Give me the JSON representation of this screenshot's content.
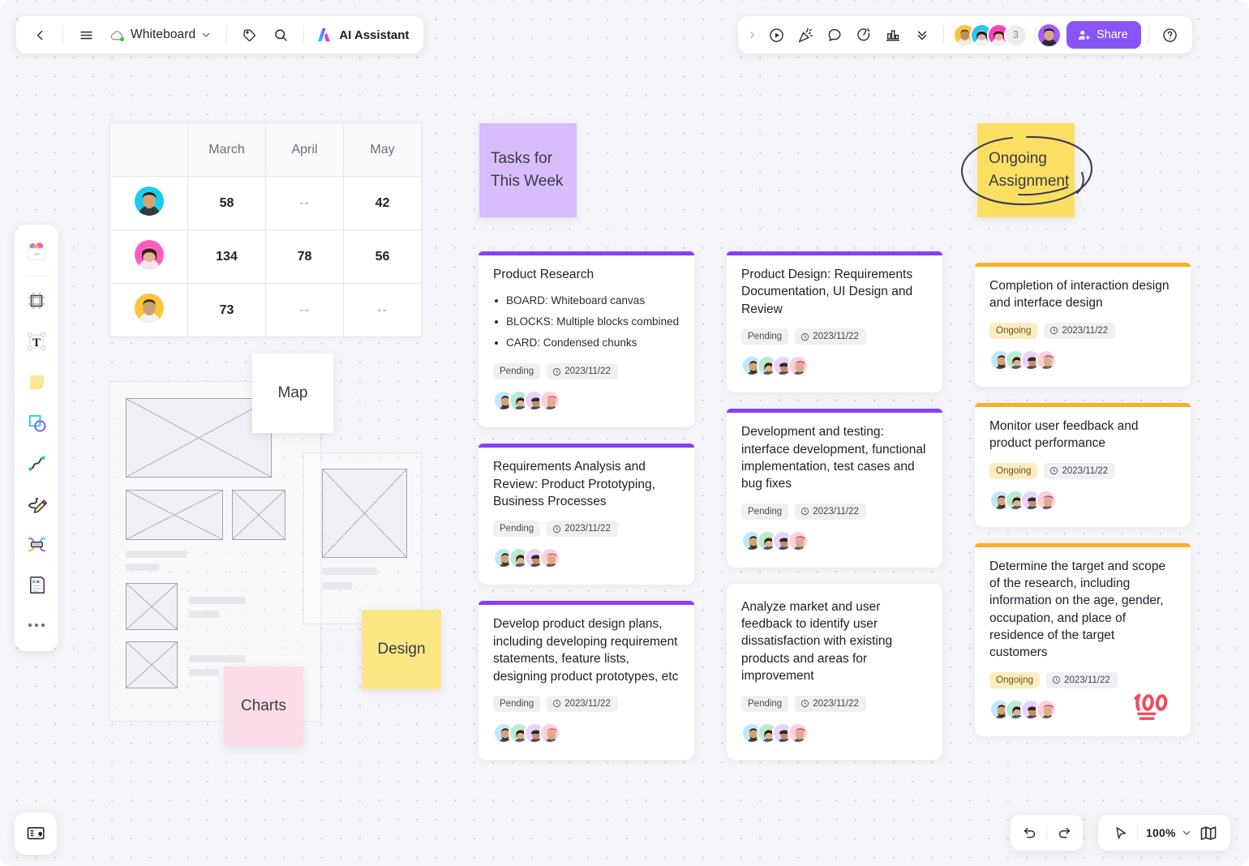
{
  "topbar": {
    "doc_title": "Whiteboard",
    "ai_label": "AI Assistant",
    "share_label": "Share",
    "member_count": "3",
    "icons": {
      "back": "back-arrow-icon",
      "menu": "hamburger-menu-icon",
      "cloud": "cloud-saved-icon",
      "chevron": "chevron-down-icon",
      "tag": "tag-icon",
      "search": "search-icon",
      "ai": "ai-sparkle-icon",
      "expand": "chevron-right-icon",
      "present": "play-circle-icon",
      "celebrate": "party-popper-icon",
      "comment": "comment-bubble-icon",
      "timer": "timer-icon",
      "chart": "bar-chart-icon",
      "more": "double-chevron-down-icon",
      "help": "help-circle-icon",
      "share": "add-person-icon"
    }
  },
  "tool_rail": [
    {
      "name": "templates-tool",
      "label": "Templates"
    },
    {
      "name": "frame-tool",
      "label": "Frame"
    },
    {
      "name": "text-tool",
      "label": "Text"
    },
    {
      "name": "sticky-note-tool",
      "label": "Sticky Note"
    },
    {
      "name": "shape-tool",
      "label": "Shape"
    },
    {
      "name": "connector-tool",
      "label": "Connector"
    },
    {
      "name": "pen-tool",
      "label": "Pen"
    },
    {
      "name": "mindmap-tool",
      "label": "Mind Map"
    },
    {
      "name": "document-tool",
      "label": "Document"
    },
    {
      "name": "more-tools",
      "label": "More"
    }
  ],
  "board_button": {
    "icon": "board-pin-icon"
  },
  "bottom_controls": {
    "undo": "undo-icon",
    "redo": "redo-icon",
    "cursor": "cursor-pointer-icon",
    "zoom_value": "100%",
    "zoom_chevron": "chevron-down-icon",
    "minimap": "minimap-icon"
  },
  "table": {
    "headers": [
      "",
      "March",
      "April",
      "May"
    ],
    "rows": [
      {
        "avatar_color": "#18cdf0",
        "values": [
          "58",
          "--",
          "42"
        ]
      },
      {
        "avatar_color": "#ff5cc0",
        "values": [
          "134",
          "78",
          "56"
        ]
      },
      {
        "avatar_color": "#fcc63a",
        "values": [
          "73",
          "--",
          "--"
        ]
      }
    ]
  },
  "sticky_notes": {
    "tasks": {
      "text": "Tasks for\nThis Week",
      "color": "#d7bdfc"
    },
    "ongoing": {
      "text": "Ongoing\nAssignment",
      "color": "#fbdf63"
    },
    "map": {
      "text": "Map",
      "color": "#ffffff"
    },
    "design": {
      "text": "Design",
      "color": "#fbe784"
    },
    "charts": {
      "text": "Charts",
      "color": "#fcdce8"
    }
  },
  "columns": [
    {
      "name": "tasks-this-week",
      "accent": "#8b3dfb",
      "cards": [
        {
          "title": "Product Research",
          "bullets": [
            "BOARD:  Whiteboard canvas",
            "BLOCKS:  Multiple blocks combined",
            "CARD:  Condensed chunks"
          ],
          "status": "Pending",
          "date": "2023/11/22"
        },
        {
          "title": "Requirements Analysis and Review: Product Prototyping, Business Processes",
          "bullets": [],
          "status": "Pending",
          "date": "2023/11/22"
        },
        {
          "title": "Develop product design plans, including developing requirement statements, feature lists, designing product prototypes, etc",
          "bullets": [],
          "status": "Pending",
          "date": "2023/11/22"
        }
      ]
    },
    {
      "name": "product-design",
      "accent": "#8b3dfb",
      "cards": [
        {
          "title": "Product Design: Requirements Documentation, UI Design and Review",
          "bullets": [],
          "status": "Pending",
          "date": "2023/11/22"
        },
        {
          "title": "Development and testing: interface development, functional implementation, test cases and bug fixes",
          "bullets": [],
          "status": "Pending",
          "date": "2023/11/22"
        },
        {
          "title": "Analyze market and user feedback to identify user dissatisfaction with existing products and areas for improvement",
          "bullets": [],
          "status": "Pending",
          "date": "2023/11/22"
        }
      ]
    },
    {
      "name": "ongoing-assignment",
      "accent": "#f9ae28",
      "cards": [
        {
          "title": "Completion of interaction design and interface design",
          "bullets": [],
          "status": "Ongoing",
          "date": "2023/11/22"
        },
        {
          "title": "Monitor user feedback and product performance",
          "bullets": [],
          "status": "Ongoing",
          "date": "2023/11/22"
        },
        {
          "title": "Determine the target and scope of the research, including information on the age, gender, occupation, and place of residence of the target customers",
          "bullets": [],
          "status": "Ongoijng",
          "date": "2023/11/22",
          "sticker": "100-emoji-sticker"
        }
      ]
    }
  ],
  "colors": {
    "accent_purple": "#8b3dfb",
    "accent_orange": "#f9ae28",
    "share_button": "#8855f7",
    "canvas": "#f6f6fa",
    "ongoing_badge": "#fdecc0",
    "pending_badge": "#f0f0f4"
  }
}
